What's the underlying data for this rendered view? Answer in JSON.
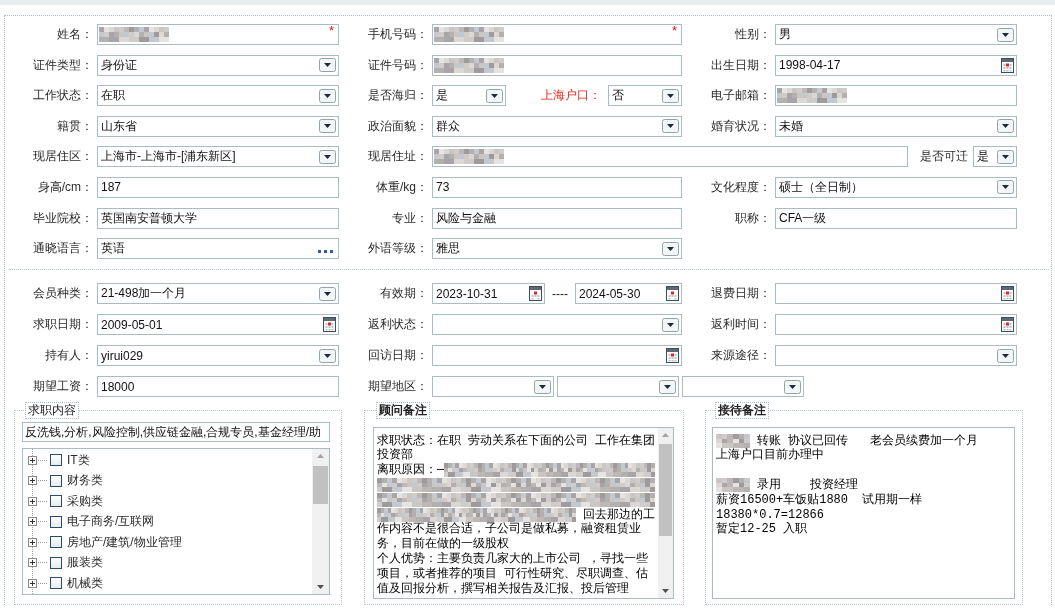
{
  "personal": {
    "rows": [
      {
        "cells": [
          {
            "kind": "single",
            "fields": [
              {
                "label": "姓名：",
                "control": {
                  "kind": "text",
                  "redacted": true,
                  "required_mark": "*"
                }
              }
            ]
          },
          {
            "kind": "single",
            "fields": [
              {
                "label": "手机号码：",
                "control": {
                  "kind": "text",
                  "redacted": true,
                  "required_mark": "*"
                }
              }
            ]
          },
          {
            "kind": "single",
            "fields": [
              {
                "label": "性别：",
                "control": {
                  "kind": "select",
                  "value": "男"
                }
              }
            ]
          }
        ]
      },
      {
        "cells": [
          {
            "kind": "single",
            "fields": [
              {
                "label": "证件类型：",
                "control": {
                  "kind": "select",
                  "value": "身份证"
                }
              }
            ]
          },
          {
            "kind": "single",
            "fields": [
              {
                "label": "证件号码：",
                "control": {
                  "kind": "text",
                  "redacted": true
                }
              }
            ]
          },
          {
            "kind": "single",
            "fields": [
              {
                "label": "出生日期：",
                "control": {
                  "kind": "date",
                  "value": "1998-04-17"
                }
              }
            ]
          }
        ]
      },
      {
        "cells": [
          {
            "kind": "single",
            "fields": [
              {
                "label": "工作状态：",
                "control": {
                  "kind": "select",
                  "value": "在职"
                }
              }
            ]
          },
          {
            "kind": "pair",
            "fields": [
              {
                "label": "是否海归：",
                "control": {
                  "kind": "select",
                  "value": "是"
                }
              },
              {
                "label": "上海户口：",
                "emphasized": true,
                "control": {
                  "kind": "select",
                  "value": "否"
                }
              }
            ]
          },
          {
            "kind": "single",
            "fields": [
              {
                "label": "电子邮箱：",
                "control": {
                  "kind": "text",
                  "redacted": true
                }
              }
            ]
          }
        ]
      },
      {
        "cells": [
          {
            "kind": "single",
            "fields": [
              {
                "label": "籍贯：",
                "control": {
                  "kind": "select",
                  "value": "山东省"
                }
              }
            ]
          },
          {
            "kind": "single",
            "fields": [
              {
                "label": "政治面貌：",
                "control": {
                  "kind": "select",
                  "value": "群众"
                }
              }
            ]
          },
          {
            "kind": "single",
            "fields": [
              {
                "label": "婚育状况：",
                "control": {
                  "kind": "select",
                  "value": "未婚"
                }
              }
            ]
          }
        ]
      },
      {
        "cells": [
          {
            "kind": "single",
            "fields": [
              {
                "label": "现居住区：",
                "control": {
                  "kind": "select",
                  "value": "上海市-上海市-[浦东新区]"
                }
              }
            ]
          },
          {
            "kind": "wide",
            "fields": [
              {
                "label": "现居住址：",
                "control": {
                  "kind": "text",
                  "redacted": true
                }
              },
              {
                "label": "是否可迁",
                "control": {
                  "kind": "select",
                  "value": "是"
                }
              }
            ]
          }
        ]
      },
      {
        "cells": [
          {
            "kind": "single",
            "fields": [
              {
                "label": "身高/cm：",
                "control": {
                  "kind": "text",
                  "value": "187"
                }
              }
            ]
          },
          {
            "kind": "single",
            "fields": [
              {
                "label": "体重/kg：",
                "control": {
                  "kind": "text",
                  "value": "73"
                }
              }
            ]
          },
          {
            "kind": "single",
            "fields": [
              {
                "label": "文化程度：",
                "control": {
                  "kind": "select",
                  "value": "硕士（全日制）"
                }
              }
            ]
          }
        ]
      },
      {
        "cells": [
          {
            "kind": "single",
            "fields": [
              {
                "label": "毕业院校：",
                "control": {
                  "kind": "text",
                  "value": "英国南安普顿大学"
                }
              }
            ]
          },
          {
            "kind": "single",
            "fields": [
              {
                "label": "专业：",
                "control": {
                  "kind": "text",
                  "value": "风险与金融"
                }
              }
            ]
          },
          {
            "kind": "single",
            "fields": [
              {
                "label": "职称：",
                "control": {
                  "kind": "text",
                  "value": "CFA一级"
                }
              }
            ]
          }
        ]
      },
      {
        "cells": [
          {
            "kind": "single",
            "fields": [
              {
                "label": "通晓语言：",
                "control": {
                  "kind": "lookup",
                  "value": "英语"
                }
              }
            ]
          },
          {
            "kind": "single",
            "fields": [
              {
                "label": "外语等级：",
                "control": {
                  "kind": "select",
                  "value": "雅思"
                }
              }
            ]
          }
        ]
      }
    ]
  },
  "membership": {
    "rows": [
      {
        "cells": [
          {
            "kind": "single",
            "fields": [
              {
                "label": "会员种类：",
                "control": {
                  "kind": "select",
                  "value": "21-498加一个月"
                }
              }
            ]
          },
          {
            "kind": "single",
            "fields": [
              {
                "label": "有效期：",
                "control": {
                  "kind": "date_range",
                  "from": "2023-10-31",
                  "separator": "----",
                  "to": "2024-05-30"
                }
              }
            ]
          },
          {
            "kind": "single",
            "fields": [
              {
                "label": "退费日期：",
                "control": {
                  "kind": "date"
                }
              }
            ]
          }
        ]
      },
      {
        "cells": [
          {
            "kind": "single",
            "fields": [
              {
                "label": "求职日期：",
                "control": {
                  "kind": "date",
                  "value": "2009-05-01"
                }
              }
            ]
          },
          {
            "kind": "single",
            "fields": [
              {
                "label": "返利状态：",
                "control": {
                  "kind": "select"
                }
              }
            ]
          },
          {
            "kind": "single",
            "fields": [
              {
                "label": "返利时间：",
                "control": {
                  "kind": "date"
                }
              }
            ]
          }
        ]
      },
      {
        "cells": [
          {
            "kind": "single",
            "fields": [
              {
                "label": "持有人：",
                "control": {
                  "kind": "select",
                  "value": "yirui029"
                }
              }
            ]
          },
          {
            "kind": "single",
            "fields": [
              {
                "label": "回访日期：",
                "control": {
                  "kind": "date"
                }
              }
            ]
          },
          {
            "kind": "single",
            "fields": [
              {
                "label": "来源途径：",
                "control": {
                  "kind": "select"
                }
              }
            ]
          }
        ]
      },
      {
        "cells": [
          {
            "kind": "single",
            "fields": [
              {
                "label": "期望工资：",
                "control": {
                  "kind": "text",
                  "value": "18000"
                }
              }
            ]
          },
          {
            "kind": "single",
            "fields": [
              {
                "label": "期望地区：",
                "control": {
                  "kind": "region"
                }
              }
            ]
          }
        ]
      }
    ]
  },
  "job_intent": {
    "legend": "求职内容",
    "summary": "反洗钱,分析,风险控制,供应链金融,合规专员,基金经理/助",
    "categories": [
      {
        "label": "IT类",
        "expanded": false,
        "checked": false
      },
      {
        "label": "财务类",
        "expanded": false,
        "checked": false
      },
      {
        "label": "采购类",
        "expanded": false,
        "checked": false
      },
      {
        "label": "电子商务/互联网",
        "expanded": false,
        "checked": false
      },
      {
        "label": "房地产/建筑/物业管理",
        "expanded": false,
        "checked": false
      },
      {
        "label": "服装类",
        "expanded": false,
        "checked": false
      },
      {
        "label": "机械类",
        "expanded": false,
        "checked": false
      }
    ]
  },
  "notes": [
    {
      "legend": "顾问备注",
      "scrollbar": true,
      "lines": [
        {
          "kind": "text",
          "segments": [
            {
              "kind": "text",
              "text": "求职状态：在职 劳动关系在下面的公司 工作在集团"
            }
          ]
        },
        {
          "kind": "text",
          "segments": [
            {
              "kind": "text",
              "text": "投资部"
            }
          ]
        },
        {
          "kind": "text",
          "segments": [
            {
              "kind": "text",
              "text": "离职原因：—"
            },
            {
              "kind": "redacted_line"
            }
          ]
        },
        {
          "kind": "text",
          "segments": [
            {
              "kind": "redacted_line"
            }
          ]
        },
        {
          "kind": "text",
          "segments": [
            {
              "kind": "redacted_line"
            }
          ]
        },
        {
          "kind": "text",
          "segments": [
            {
              "kind": "redacted_line"
            },
            {
              "kind": "text",
              "text": " 回去那边的工"
            }
          ]
        },
        {
          "kind": "text",
          "segments": [
            {
              "kind": "text",
              "text": "作内容不是很合适，子公司是做私募，融资租赁业"
            }
          ]
        },
        {
          "kind": "text",
          "segments": [
            {
              "kind": "text",
              "text": "务，目前在做的一级股权"
            }
          ]
        },
        {
          "kind": "text",
          "segments": [
            {
              "kind": "text",
              "text": "个人优势：主要负责几家大的上市公司 ，寻找一些"
            }
          ]
        },
        {
          "kind": "text",
          "segments": [
            {
              "kind": "text",
              "text": "项目，或者推荐的项目 可行性研究、尽职调查、估"
            }
          ]
        },
        {
          "kind": "text",
          "segments": [
            {
              "kind": "text",
              "text": "值及回报分析，撰写相关报告及汇报、投后管理"
            }
          ]
        }
      ]
    },
    {
      "legend": "接待备注",
      "scrollbar": false,
      "lines": [
        {
          "kind": "text",
          "segments": [
            {
              "kind": "redacted_word"
            },
            {
              "kind": "text",
              "text": " 转账 协议已回传   老会员续费加一个月"
            }
          ]
        },
        {
          "kind": "text",
          "segments": [
            {
              "kind": "text",
              "text": "上海户口目前办理中"
            }
          ]
        },
        {
          "kind": "blank"
        },
        {
          "kind": "text",
          "segments": [
            {
              "kind": "redacted_word"
            },
            {
              "kind": "text",
              "text": " 录用    投资经理"
            }
          ]
        },
        {
          "kind": "text",
          "segments": [
            {
              "kind": "text",
              "text": "薪资16500+车饭贴1880  试用期一样"
            }
          ]
        },
        {
          "kind": "text",
          "segments": [
            {
              "kind": "text",
              "text": "18380*0.7=12866"
            }
          ]
        },
        {
          "kind": "text",
          "segments": [
            {
              "kind": "text",
              "text": "暂定12-25 入职"
            }
          ]
        }
      ]
    }
  ]
}
